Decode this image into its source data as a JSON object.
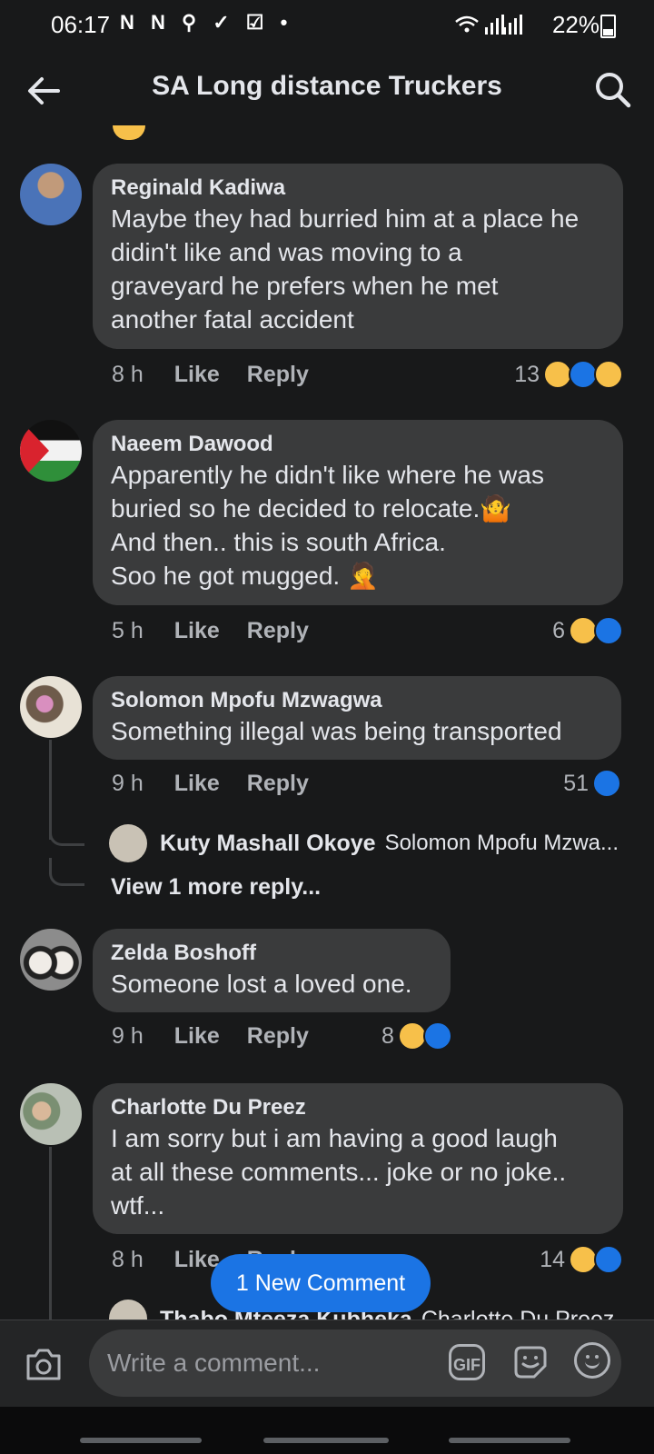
{
  "status": {
    "time": "06:17",
    "notif_glyphs": "N N ⚲ ✓ ☑ •",
    "battery": "22%"
  },
  "header": {
    "title": "SA Long distance Truckers",
    "icons": [
      "arrow-left-icon",
      "search-icon"
    ]
  },
  "comments": [
    {
      "author": "Reginald Kadiwa",
      "text": "Maybe they had burried him at a place he\ndidin't like and was moving to a\ngraveyard he prefers when he met\nanother fatal accident",
      "time": "8 h",
      "like_label": "Like",
      "reply_label": "Reply",
      "reaction_count": "13",
      "reactions": [
        "haha",
        "like",
        "sad"
      ]
    },
    {
      "author": "Naeem Dawood",
      "text": "Apparently he didn't like where he was\nburied so he decided to relocate.🤷\nAnd then.. this is south Africa.\nSoo he got mugged. 🤦",
      "time": "5 h",
      "like_label": "Like",
      "reply_label": "Reply",
      "reaction_count": "6",
      "reactions": [
        "haha",
        "like"
      ]
    },
    {
      "author": "Solomon Mpofu Mzwagwa",
      "text": "Something illegal was being transported",
      "time": "9 h",
      "like_label": "Like",
      "reply_label": "Reply",
      "reaction_count": "51",
      "reactions": [
        "like"
      ],
      "reply_preview": {
        "author": "Kuty Mashall Okoye",
        "snippet": "Solomon Mpofu Mzwa..."
      },
      "view_more": "View 1 more reply..."
    },
    {
      "author": "Zelda Boshoff",
      "text": "Someone lost a loved one.",
      "time": "9 h",
      "like_label": "Like",
      "reply_label": "Reply",
      "reaction_count": "8",
      "reactions": [
        "haha",
        "like"
      ]
    },
    {
      "author": "Charlotte Du Preez",
      "text": "I am sorry but i am having a good  laugh\nat all these comments... joke or no joke..\nwtf...",
      "time": "8 h",
      "like_label": "Like",
      "reply_label": "Reply",
      "reaction_count": "14",
      "reactions": [
        "haha",
        "like"
      ]
    }
  ],
  "partial_reply": {
    "author": "Thabo Mteeza Kubheka",
    "snippet": "Charlotte Du Preez"
  },
  "new_comment_pill": "1 New Comment",
  "composer": {
    "placeholder": "Write a comment...",
    "gif_label": "GIF",
    "icons": [
      "camera-icon",
      "sticker-icon",
      "emoji-icon"
    ]
  },
  "colors": {
    "background": "#18191a",
    "bubble": "#3a3b3c",
    "accent": "#1b74e4",
    "haha": "#f7c04a"
  }
}
